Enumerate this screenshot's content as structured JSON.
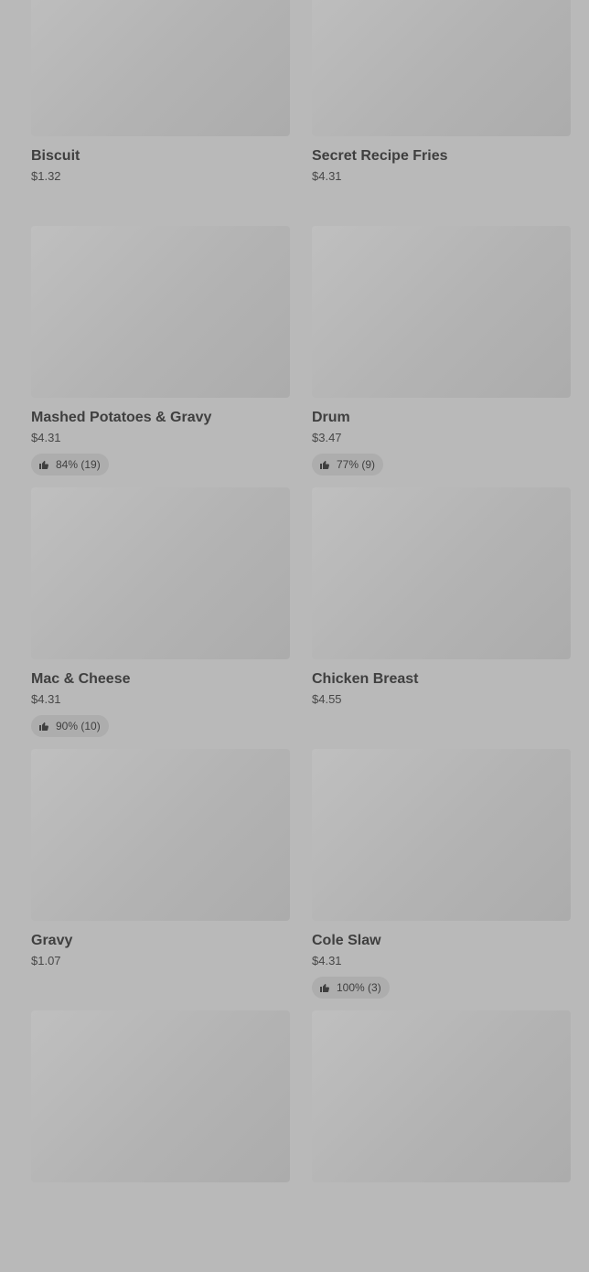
{
  "menu": {
    "items": [
      {
        "name": "Biscuit",
        "price": "$1.32",
        "rating": null
      },
      {
        "name": "Secret Recipe Fries",
        "price": "$4.31",
        "rating": null
      },
      {
        "name": "Mashed Potatoes & Gravy",
        "price": "$4.31",
        "rating": "84% (19)"
      },
      {
        "name": "Drum",
        "price": "$3.47",
        "rating": "77% (9)"
      },
      {
        "name": "Mac & Cheese",
        "price": "$4.31",
        "rating": "90% (10)"
      },
      {
        "name": "Chicken Breast",
        "price": "$4.55",
        "rating": null
      },
      {
        "name": "Gravy",
        "price": "$1.07",
        "rating": null
      },
      {
        "name": "Cole Slaw",
        "price": "$4.31",
        "rating": "100% (3)"
      },
      {
        "name": "",
        "price": "",
        "rating": null
      },
      {
        "name": "",
        "price": "",
        "rating": null
      }
    ]
  },
  "icons": {
    "rating": "thumbs-up-icon"
  },
  "colors": {
    "overlay_background": "#b9b9b9",
    "thumbnail_placeholder": "#b3b3b3",
    "rating_pill": "#adadad"
  }
}
